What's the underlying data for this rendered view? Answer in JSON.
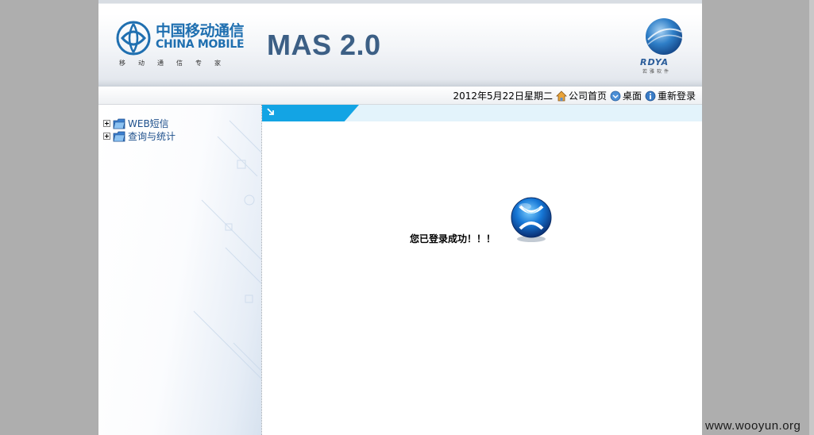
{
  "header": {
    "brand_cn": "中国移动通信",
    "brand_en": "CHINA MOBILE",
    "brand_tagline": "移动通信专家",
    "product_title": "MAS 2.0",
    "partner_logo": "RDYA",
    "partner_sub": "若雅软件"
  },
  "toolbar": {
    "date_text": "2012年5月22日星期二",
    "home_label": "公司首页",
    "desktop_label": "桌面",
    "relogin_label": "重新登录",
    "home_icon": "home-icon",
    "desktop_icon": "desktop-icon",
    "relogin_icon": "relogin-icon"
  },
  "sidebar": {
    "items": [
      {
        "label": "WEB短信",
        "icon": "folder-icon"
      },
      {
        "label": "查询与统计",
        "icon": "folder-icon"
      }
    ]
  },
  "content": {
    "message": "您已登录成功！！！",
    "accent_color": "#13a4e4"
  },
  "watermark": "www.wooyun.org"
}
